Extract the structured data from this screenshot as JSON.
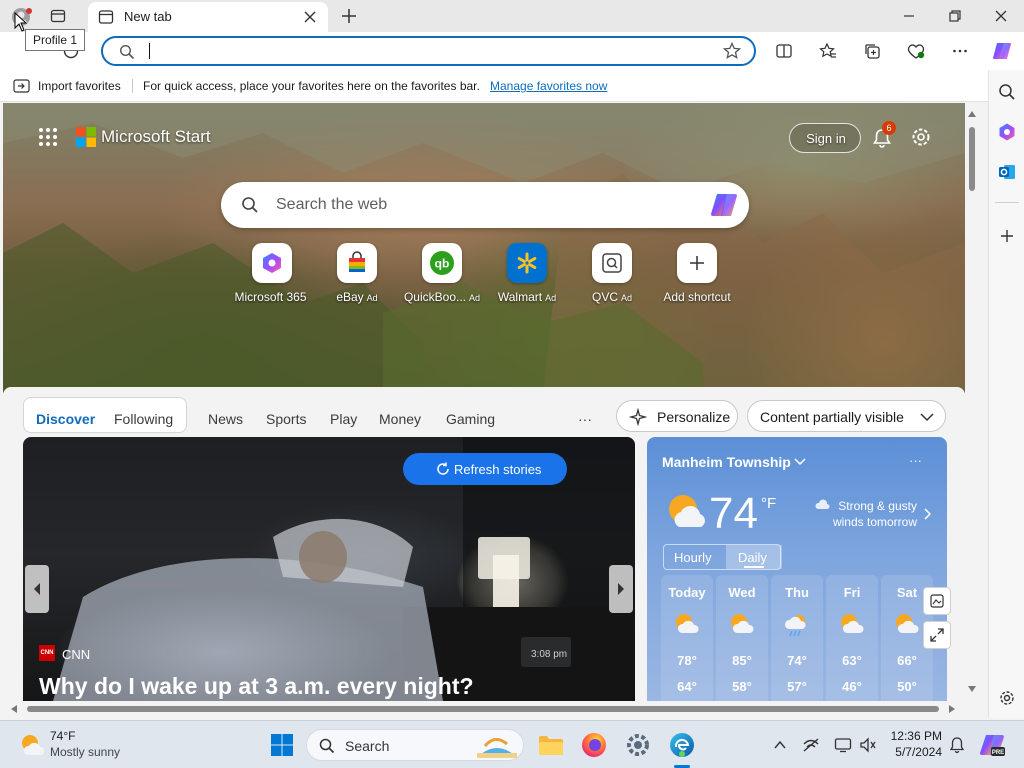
{
  "browser": {
    "tab_title": "New tab",
    "tooltip": "Profile 1",
    "address_value": "",
    "favorites_bar": {
      "import_label": "Import favorites",
      "message": "For quick access, place your favorites here on the favorites bar.",
      "manage_link": "Manage favorites now"
    }
  },
  "start_page": {
    "brand": "Microsoft Start",
    "sign_in": "Sign in",
    "notification_count": "6",
    "search_placeholder": "Search the web",
    "shortcuts": [
      {
        "label": "Microsoft 365",
        "ad": ""
      },
      {
        "label": "eBay",
        "ad": "Ad"
      },
      {
        "label": "QuickBoo...",
        "ad": "Ad"
      },
      {
        "label": "Walmart",
        "ad": "Ad"
      },
      {
        "label": "QVC",
        "ad": "Ad"
      },
      {
        "label": "Add shortcut",
        "ad": ""
      }
    ],
    "feed_tabs": {
      "discover": "Discover",
      "following": "Following",
      "news": "News",
      "sports": "Sports",
      "play": "Play",
      "money": "Money",
      "gaming": "Gaming",
      "more": "···"
    },
    "personalize": "Personalize",
    "content_visibility": "Content partially visible",
    "refresh_stories": "Refresh stories",
    "story": {
      "source": "CNN",
      "source_logo": "CNN",
      "headline": "Why do I wake up at 3 a.m. every night?",
      "clock_text": "3:08 pm"
    },
    "weather": {
      "location": "Manheim Township",
      "more": "···",
      "temperature": "74",
      "unit": "°F",
      "alert_line1": "Strong & gusty",
      "alert_line2": "winds tomorrow",
      "toggle_hourly": "Hourly",
      "toggle_daily": "Daily",
      "forecast": [
        {
          "day": "Today",
          "hi": "78°",
          "lo": "64°",
          "icon": "partly-cloudy"
        },
        {
          "day": "Wed",
          "hi": "85°",
          "lo": "58°",
          "icon": "partly-cloudy"
        },
        {
          "day": "Thu",
          "hi": "74°",
          "lo": "57°",
          "icon": "rain-showers"
        },
        {
          "day": "Fri",
          "hi": "63°",
          "lo": "46°",
          "icon": "partly-cloudy"
        },
        {
          "day": "Sat",
          "hi": "66°",
          "lo": "50°",
          "icon": "partly-cloudy"
        }
      ]
    }
  },
  "taskbar": {
    "weather_temp": "74°F",
    "weather_desc": "Mostly sunny",
    "search_label": "Search",
    "time": "12:36 PM",
    "date": "5/7/2024"
  },
  "colors": {
    "accent": "#0f6cbd",
    "refresh_button": "#1a73e8",
    "notification_badge": "#d83b01"
  }
}
